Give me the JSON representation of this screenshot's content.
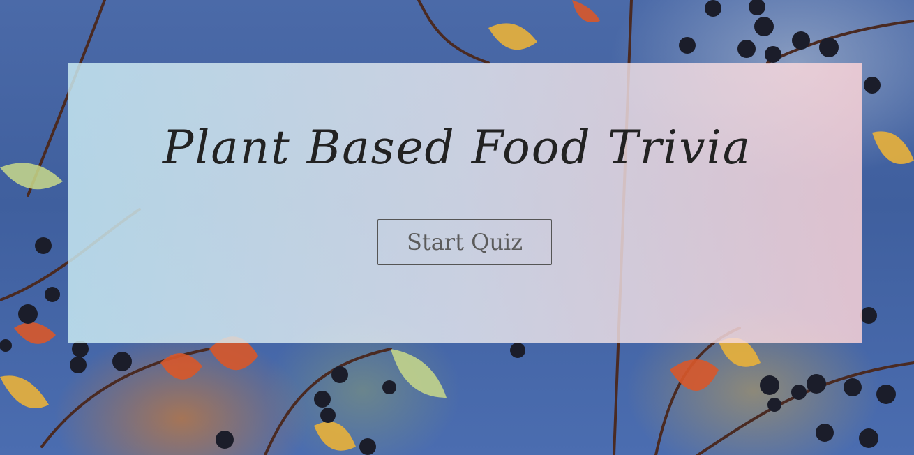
{
  "page": {
    "title": "Plant Based Food Trivia",
    "start_button_label": "Start Quiz"
  },
  "background": {
    "description_icon": "autumn-berries-photo",
    "sky_color": "#4b6aa8",
    "berry_color": "#1b1d2a",
    "leaf_colors": [
      "#d8582a",
      "#e9b13a",
      "#c9d98a"
    ]
  },
  "panel": {
    "tint_left": "#cdeef5",
    "tint_right": "#fcd4d8"
  }
}
